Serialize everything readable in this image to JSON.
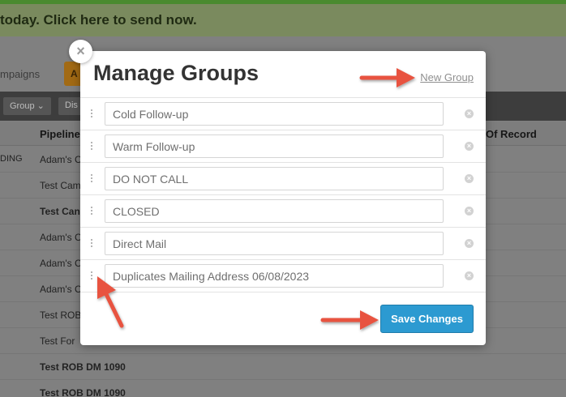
{
  "background": {
    "banner_text": "today. Click here to send now.",
    "tabs": {
      "campaigns_label": "mpaigns",
      "orange_button_label": "A"
    },
    "toolbar": {
      "group_label": "Group ⌄",
      "other_label": "Dis"
    },
    "table": {
      "status_cell": "DING",
      "headers": {
        "pipeline": "Pipeline",
        "of_record": "Of Record"
      },
      "rows": [
        {
          "label": "Adam's C",
          "bold": false
        },
        {
          "label": "Test Cam",
          "bold": false
        },
        {
          "label": "Test Can",
          "bold": true
        },
        {
          "label": "Adam's C",
          "bold": false
        },
        {
          "label": "Adam's C",
          "bold": false
        },
        {
          "label": "Adam's C",
          "bold": false
        },
        {
          "label": "Test ROB",
          "bold": false
        },
        {
          "label": "Test For",
          "bold": false
        },
        {
          "label": "Test ROB DM 1090",
          "bold": true
        },
        {
          "label": "Test ROB DM 1090",
          "bold": true
        }
      ]
    }
  },
  "modal": {
    "close_glyph": "×",
    "title": "Manage Groups",
    "new_group_label": "New Group",
    "groups": [
      {
        "value": "Cold Follow-up"
      },
      {
        "value": "Warm Follow-up"
      },
      {
        "value": "DO NOT CALL"
      },
      {
        "value": "CLOSED"
      },
      {
        "value": "Direct Mail"
      },
      {
        "value": "Duplicates Mailing Address 06/08/2023"
      }
    ],
    "remove_glyph": "×",
    "save_label": "Save Changes"
  },
  "colors": {
    "accent": "#2c9ad1",
    "annotation_arrow": "#e8533f"
  }
}
